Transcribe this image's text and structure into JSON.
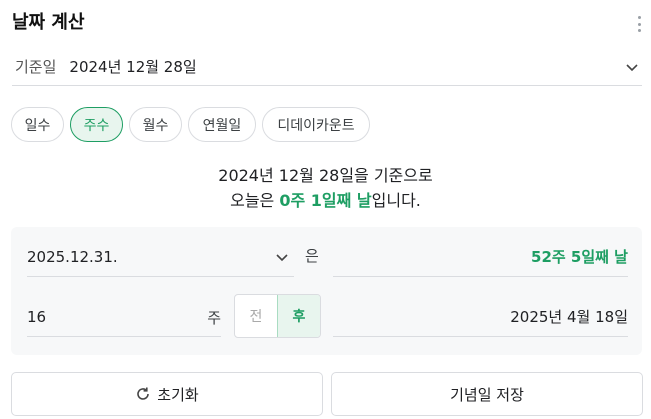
{
  "header": {
    "title": "날짜 계산",
    "menu_icon": "kebab-menu-icon"
  },
  "base": {
    "label": "기준일",
    "value": "2024년 12월 28일"
  },
  "tabs": [
    {
      "label": "일수",
      "active": false
    },
    {
      "label": "주수",
      "active": true
    },
    {
      "label": "월수",
      "active": false
    },
    {
      "label": "연월일",
      "active": false
    },
    {
      "label": "디데이카운트",
      "active": false
    }
  ],
  "summary": {
    "line1": "2024년 12월 28일을 기준으로",
    "line2_prefix": "오늘은 ",
    "line2_highlight": "0주 1일째 날",
    "line2_suffix": "입니다."
  },
  "calc": {
    "date_value": "2025.12.31.",
    "particle": "은",
    "result_weeks": "52주 5일째 날",
    "number_value": "16",
    "number_unit": "주",
    "direction": {
      "before": "전",
      "after": "후",
      "selected": "후"
    },
    "result_date": "2025년 4월 18일"
  },
  "actions": {
    "reset_label": "초기화",
    "save_label": "기념일 저장"
  },
  "colors": {
    "accent": "#1e9e63",
    "accent_bg": "#e8f5ee",
    "border": "#dadce0",
    "panel_bg": "#f7f8f9"
  }
}
